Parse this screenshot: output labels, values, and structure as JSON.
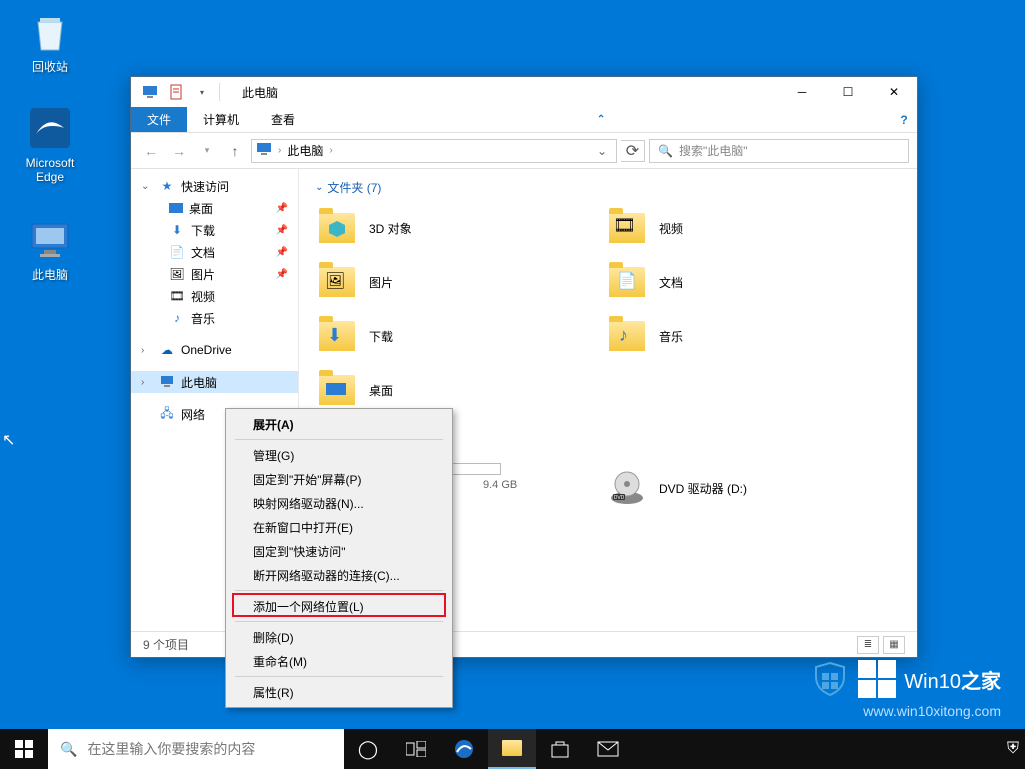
{
  "desktop": {
    "recycle": "回收站",
    "edge": "Microsoft\nEdge",
    "thispc": "此电脑"
  },
  "explorer": {
    "title": "此电脑",
    "tabs": {
      "file": "文件",
      "computer": "计算机",
      "view": "查看"
    },
    "address": {
      "thispc": "此电脑"
    },
    "search_placeholder": "搜索\"此电脑\"",
    "nav": {
      "quick": "快速访问",
      "desktop": "桌面",
      "downloads": "下载",
      "documents": "文档",
      "pictures": "图片",
      "videos": "视频",
      "music": "音乐",
      "onedrive": "OneDrive",
      "thispc": "此电脑",
      "network": "网络"
    },
    "groups": {
      "folders": "文件夹 (7)"
    },
    "folders": {
      "objects3d": "3D 对象",
      "videos": "视频",
      "pictures": "图片",
      "documents": "文档",
      "downloads": "下载",
      "music": "音乐",
      "desktop": "桌面"
    },
    "drives": {
      "dvd": "DVD 驱动器 (D:)",
      "free": "9.4 GB"
    },
    "status": "9 个项目"
  },
  "ctx": {
    "expand": "展开(A)",
    "manage": "管理(G)",
    "pin_start": "固定到\"开始\"屏幕(P)",
    "map_drive": "映射网络驱动器(N)...",
    "open_new": "在新窗口中打开(E)",
    "pin_quick": "固定到\"快速访问\"",
    "disconnect": "断开网络驱动器的连接(C)...",
    "add_loc": "添加一个网络位置(L)",
    "delete": "删除(D)",
    "rename": "重命名(M)",
    "properties": "属性(R)"
  },
  "taskbar": {
    "search": "在这里输入你要搜索的内容"
  },
  "watermark": {
    "brand1": "Win10",
    "brand2": "之家",
    "url": "www.win10xitong.com"
  }
}
